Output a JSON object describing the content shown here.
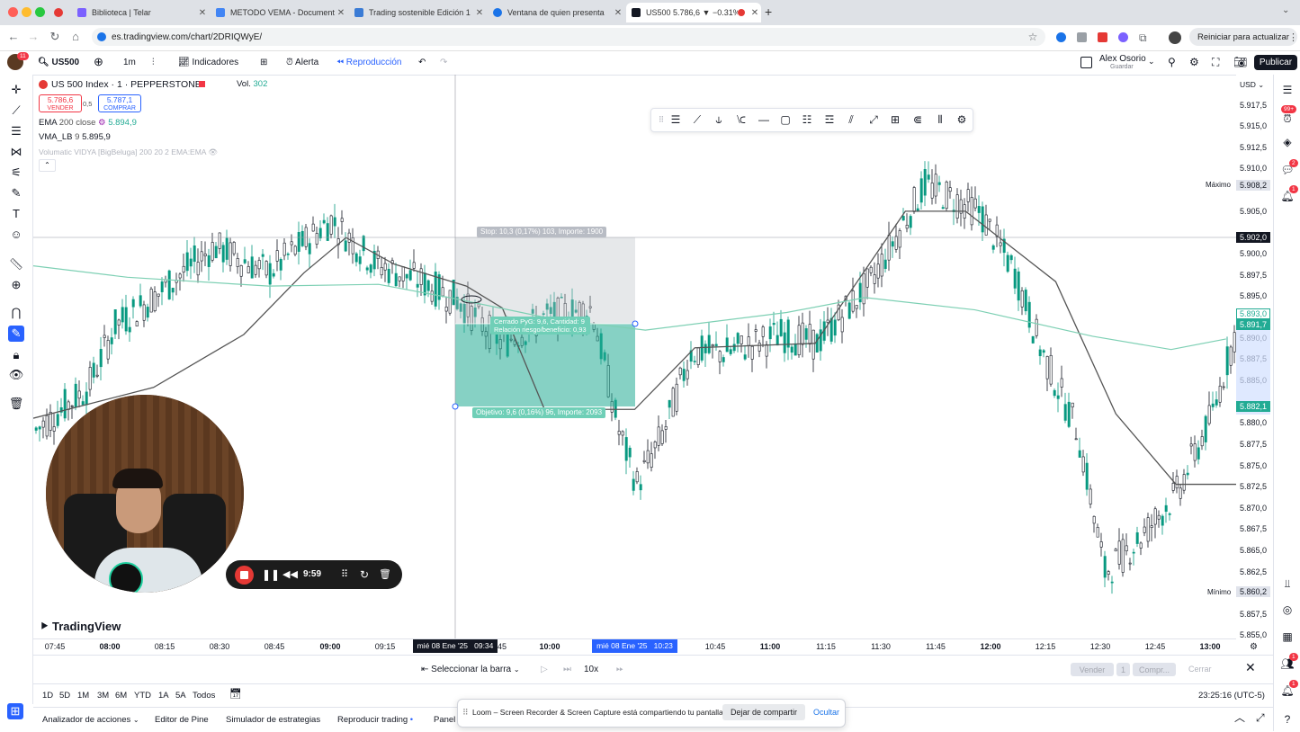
{
  "browser": {
    "tabs": [
      {
        "label": "Biblioteca | Telar",
        "favicon_color": "#7b61ff"
      },
      {
        "label": "METODO VEMA - Documento",
        "favicon_color": "#4285f4"
      },
      {
        "label": "Trading sostenible Edición 1",
        "favicon_color": "#3a7bd5"
      },
      {
        "label": "Ventana de quien presenta",
        "favicon_color": "#1a73e8"
      },
      {
        "label": "US500 5.786,6 ▼ −0.31%",
        "favicon_color": "#131722"
      }
    ],
    "url": "es.tradingview.com/chart/2DRIQWyE/",
    "restart_label": "Reiniciar para actualizar"
  },
  "toolbar": {
    "symbol": "US500",
    "interval": "1m",
    "indicators_label": "Indicadores",
    "alert_label": "Alerta",
    "replay_label": "Reproducción",
    "user_name": "Alex Osorio",
    "user_sub": "Guardar",
    "publish_label": "Publicar",
    "notif_count": "11"
  },
  "legend": {
    "title": "US 500 Index · 1 · PEPPERSTONE",
    "vol_label": "Vol.",
    "vol_value": "302",
    "sell_price": "5.786,6",
    "sell_label": "VENDER",
    "spread": "0,5",
    "buy_price": "5.787,1",
    "buy_label": "COMPRAR",
    "ema_label": "EMA",
    "ema_params": "200 close",
    "ema_value": "5.894,9",
    "vma_label": "VMA_LB",
    "vma_params": "9",
    "vma_value": "5.895,9",
    "vidya_label": "Volumatic VIDYA [BigBeluga] 200 20 2 EMA:EMA"
  },
  "position": {
    "stop_text": "Stop: 10,3 (0,17%) 103, Importe: 1900",
    "closed_text": "Cerrado PyG: 9,6, Cantidad: 9",
    "ratio_text": "Relación riesgo/beneficio: 0,93",
    "target_text": "Objetivo: 9,6 (0,16%) 96, Importe: 2093"
  },
  "price_axis": {
    "currency": "USD",
    "labels": [
      "5.917,5",
      "5.915,0",
      "5.912,5",
      "5.910,0",
      "5.905,0",
      "5.900,0",
      "5.897,5",
      "5.895,0",
      "5.890,0",
      "5.887,5",
      "5.885,0",
      "5.880,0",
      "5.877,5",
      "5.875,0",
      "5.872,5",
      "5.870,0",
      "5.867,5",
      "5.865,0",
      "5.862,5",
      "5.857,5",
      "5.855,0"
    ],
    "max_label": "Máximo",
    "max_value": "5.908,2",
    "min_label": "Mínimo",
    "min_value": "5.860,2",
    "crosshair_value": "5.902,0",
    "stop_tag": "5.893,0",
    "last_tag": "5.891,7",
    "target_tag": "5.882,1"
  },
  "time_axis": {
    "labels": [
      {
        "t": "07:45",
        "bold": false
      },
      {
        "t": "08:00",
        "bold": true
      },
      {
        "t": "08:15",
        "bold": false
      },
      {
        "t": "08:30",
        "bold": false
      },
      {
        "t": "08:45",
        "bold": false
      },
      {
        "t": "09:00",
        "bold": true
      },
      {
        "t": "09:15",
        "bold": false
      },
      {
        "t": "10:00",
        "bold": true
      },
      {
        "t": "10:45",
        "bold": false
      },
      {
        "t": "11:00",
        "bold": true
      },
      {
        "t": "11:15",
        "bold": false
      },
      {
        "t": "11:30",
        "bold": false
      },
      {
        "t": "11:45",
        "bold": false
      },
      {
        "t": "12:00",
        "bold": true
      },
      {
        "t": "12:15",
        "bold": false
      },
      {
        "t": "12:30",
        "bold": false
      },
      {
        "t": "12:45",
        "bold": false
      },
      {
        "t": "13:00",
        "bold": true
      }
    ],
    "cursor_label": "mié 08 Ene '25   09:34",
    "partial_label": "45",
    "range_label": "mié 08 Ene '25   10:23"
  },
  "chart_data": {
    "type": "candlestick",
    "symbol": "US 500 Index",
    "interval": "1",
    "x_range": [
      "07:45",
      "13:00"
    ],
    "y_range": [
      5855.0,
      5918.0
    ],
    "series": [
      {
        "name": "EMA",
        "points": [
          [
            0,
            5896.8
          ],
          [
            0.12,
            5895.5
          ],
          [
            0.3,
            5894.5
          ],
          [
            0.44,
            5894.7
          ],
          [
            0.53,
            5893.2
          ],
          [
            0.66,
            5890.8
          ],
          [
            0.78,
            5889.5
          ],
          [
            0.96,
            5891.5
          ],
          [
            1.06,
            5893.2
          ],
          [
            1.2,
            5891.8
          ],
          [
            1.35,
            5888.8
          ],
          [
            1.45,
            5887.3
          ],
          [
            1.52,
            5888.5
          ]
        ]
      },
      {
        "name": "VMA_LB",
        "points": [
          [
            0.0,
            5879.5
          ],
          [
            0.2,
            5883
          ],
          [
            0.35,
            5889
          ],
          [
            0.45,
            5896
          ],
          [
            0.52,
            5900
          ],
          [
            0.6,
            5897
          ],
          [
            0.72,
            5894.5
          ],
          [
            0.78,
            5892
          ],
          [
            0.85,
            5880.5
          ],
          [
            1.0,
            5880.5
          ],
          [
            1.1,
            5887.5
          ],
          [
            1.3,
            5888
          ],
          [
            1.45,
            5903
          ],
          [
            1.55,
            5903
          ],
          [
            1.7,
            5895
          ],
          [
            1.8,
            5880
          ],
          [
            1.9,
            5872
          ],
          [
            2.1,
            5872
          ]
        ]
      }
    ],
    "price_high_label": "5.908,2",
    "price_low_label": "5.860,2"
  },
  "replay_bar": {
    "select_bar_label": "Seleccionar la barra",
    "speed": "10x",
    "sell_label": "Vender",
    "qty": "1",
    "buy_label": "Compr...",
    "close_label": "Cerrar"
  },
  "ranges": [
    "1D",
    "5D",
    "1M",
    "3M",
    "6M",
    "YTD",
    "1A",
    "5A",
    "Todos"
  ],
  "clock": "23:25:16 (UTC-5)",
  "bottom_tabs": [
    "Analizador de acciones",
    "Editor de Pine",
    "Simulador de estrategias",
    "Reproducir trading",
    "Panel"
  ],
  "brand": "TradingView",
  "recorder": {
    "time": "9:59"
  },
  "loom": {
    "message": "Loom – Screen Recorder & Screen Capture está compartiendo tu pantalla.",
    "stop_label": "Dejar de compartir",
    "hide_label": "Ocultar"
  },
  "right_badges": {
    "top": "99+",
    "chat": "2",
    "alerts": "1",
    "b1": "1",
    "b2": "1"
  }
}
